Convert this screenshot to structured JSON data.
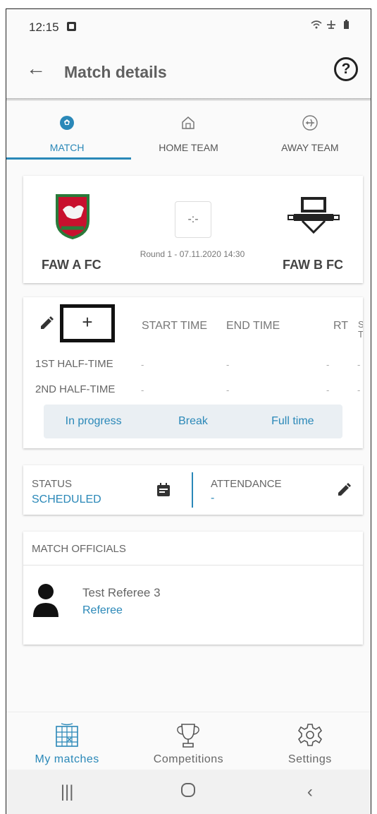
{
  "status_bar": {
    "time": "12:15",
    "right_icons": "wifi airplane battery"
  },
  "header": {
    "title": "Match details",
    "back_icon": "arrow-left-icon",
    "help_label": "?"
  },
  "tabs": [
    {
      "label": "MATCH",
      "icon": "soccer-ball-icon",
      "active": true
    },
    {
      "label": "HOME TEAM",
      "icon": "home-icon",
      "active": false
    },
    {
      "label": "AWAY TEAM",
      "icon": "airplane-icon",
      "active": false
    }
  ],
  "match": {
    "home_team": "FAW A FC",
    "away_team": "FAW B FC",
    "score": "-:-",
    "round_info": "Round 1 - 07.11.2020 14:30"
  },
  "times": {
    "add_label": "+",
    "headers": [
      "START TIME",
      "END TIME",
      "RT",
      "S T"
    ],
    "rows": [
      {
        "label": "1ST HALF-TIME",
        "values": [
          "-",
          "-",
          "-",
          "-"
        ]
      },
      {
        "label": "2ND HALF-TIME",
        "values": [
          "-",
          "-",
          "-",
          "-"
        ]
      }
    ],
    "buttons": [
      "In progress",
      "Break",
      "Full time"
    ]
  },
  "status": {
    "status_label": "STATUS",
    "status_value": "SCHEDULED",
    "attendance_label": "ATTENDANCE",
    "attendance_value": "-"
  },
  "officials": {
    "title": "MATCH OFFICIALS",
    "items": [
      {
        "name": "Test Referee 3",
        "role": "Referee"
      }
    ]
  },
  "bottom_nav": [
    {
      "label": "My matches",
      "icon": "calendar-grid-icon",
      "active": true
    },
    {
      "label": "Competitions",
      "icon": "trophy-icon",
      "active": false
    },
    {
      "label": "Settings",
      "icon": "gear-icon",
      "active": false
    }
  ],
  "colors": {
    "accent": "#2a88b8",
    "button_bg": "#eaeff3"
  }
}
